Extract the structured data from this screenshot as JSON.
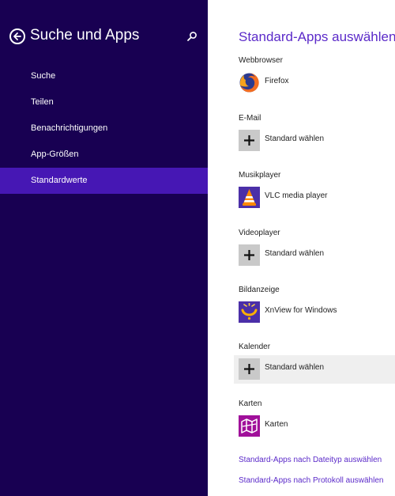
{
  "sidebar": {
    "title": "Suche und Apps",
    "back_icon": "back-arrow-circle-icon",
    "search_icon": "search-icon",
    "items": [
      {
        "label": "Suche"
      },
      {
        "label": "Teilen"
      },
      {
        "label": "Benachrichtigungen"
      },
      {
        "label": "App-Größen"
      },
      {
        "label": "Standardwerte",
        "selected": true
      }
    ],
    "colors": {
      "background": "#180052",
      "selected": "#4617b4"
    }
  },
  "main": {
    "title": "Standard-Apps auswählen",
    "accent_color": "#5b2ac9",
    "sections": [
      {
        "label": "Webbrowser",
        "app": "Firefox",
        "icon": "firefox-icon"
      },
      {
        "label": "E-Mail",
        "app": "Standard wählen",
        "icon": "plus-icon"
      },
      {
        "label": "Musikplayer",
        "app": "VLC media player",
        "icon": "vlc-icon"
      },
      {
        "label": "Videoplayer",
        "app": "Standard wählen",
        "icon": "plus-icon"
      },
      {
        "label": "Bildanzeige",
        "app": "XnView for Windows",
        "icon": "xnview-icon"
      },
      {
        "label": "Kalender",
        "app": "Standard wählen",
        "icon": "plus-icon",
        "hovered": true
      },
      {
        "label": "Karten",
        "app": "Karten",
        "icon": "maps-icon"
      }
    ],
    "links": [
      {
        "label": "Standard-Apps nach Dateityp auswählen"
      },
      {
        "label": "Standard-Apps nach Protokoll auswählen"
      }
    ]
  }
}
